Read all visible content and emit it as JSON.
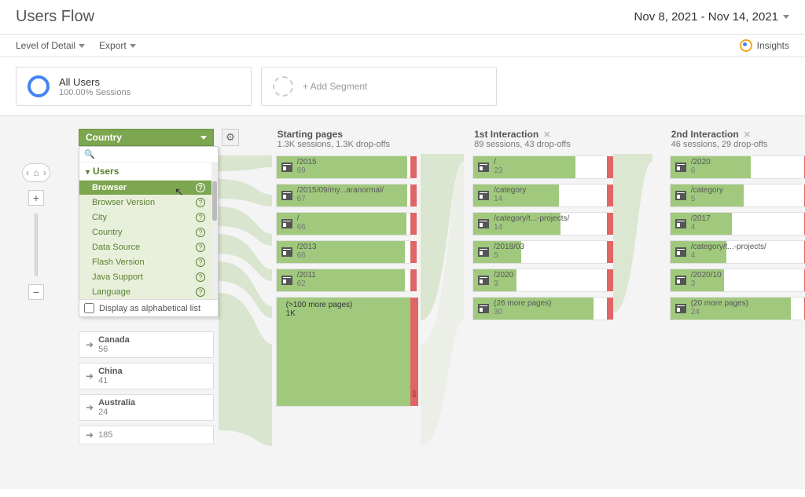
{
  "page_title": "Users Flow",
  "date_range": "Nov 8, 2021 - Nov 14, 2021",
  "toolbar": {
    "level_label": "Level of Detail",
    "export_label": "Export",
    "insights_label": "Insights"
  },
  "segments": {
    "primary_name": "All Users",
    "primary_sub": "100.00% Sessions",
    "add_label": "+ Add Segment"
  },
  "dimension_selector": {
    "selected": "Country",
    "search_placeholder": "",
    "group_header": "Users",
    "items": [
      {
        "label": "Browser",
        "selected": true
      },
      {
        "label": "Browser Version",
        "selected": false
      },
      {
        "label": "City",
        "selected": false
      },
      {
        "label": "Country",
        "selected": false
      },
      {
        "label": "Data Source",
        "selected": false
      },
      {
        "label": "Flash Version",
        "selected": false
      },
      {
        "label": "Java Support",
        "selected": false
      },
      {
        "label": "Language",
        "selected": false
      }
    ],
    "alpha_label": "Display as alphabetical list"
  },
  "dimension_values": [
    {
      "name": "Canada",
      "count": "56"
    },
    {
      "name": "China",
      "count": "41"
    },
    {
      "name": "Australia",
      "count": "24"
    },
    {
      "name": "",
      "count": "185"
    }
  ],
  "columns": [
    {
      "title": "Starting pages",
      "subtitle": "1.3K sessions, 1.3K drop-offs",
      "closable": false,
      "nodes": [
        {
          "path": "/2015",
          "value": "69",
          "bar_pct": 98,
          "drop": true
        },
        {
          "path": "/2015/09/my...aranormal/",
          "value": "67",
          "bar_pct": 98,
          "drop": true
        },
        {
          "path": "/",
          "value": "66",
          "bar_pct": 97,
          "drop": true
        },
        {
          "path": "/2013",
          "value": "66",
          "bar_pct": 96,
          "drop": true
        },
        {
          "path": "/2011",
          "value": "62",
          "bar_pct": 96,
          "drop": true
        }
      ],
      "more": {
        "path": "(>100 more pages)",
        "value": "1K",
        "big": true
      }
    },
    {
      "title": "1st Interaction",
      "subtitle": "89 sessions, 43 drop-offs",
      "closable": true,
      "nodes": [
        {
          "path": "/",
          "value": "23",
          "bar_pct": 76,
          "drop": true
        },
        {
          "path": "/category",
          "value": "14",
          "bar_pct": 64,
          "drop": true
        },
        {
          "path": "/category/t...-projects/",
          "value": "14",
          "bar_pct": 65,
          "drop": true
        },
        {
          "path": "/2018/03",
          "value": "5",
          "bar_pct": 36,
          "drop": true
        },
        {
          "path": "/2020",
          "value": "3",
          "bar_pct": 32,
          "drop": true
        }
      ],
      "more": {
        "path": "(26 more pages)",
        "value": "30",
        "big": false
      }
    },
    {
      "title": "2nd Interaction",
      "subtitle": "46 sessions, 29 drop-offs",
      "closable": true,
      "nodes": [
        {
          "path": "/2020",
          "value": "6",
          "bar_pct": 60,
          "drop": true
        },
        {
          "path": "/category",
          "value": "5",
          "bar_pct": 55,
          "drop": true
        },
        {
          "path": "/2017",
          "value": "4",
          "bar_pct": 46,
          "drop": true
        },
        {
          "path": "/category/t...-projects/",
          "value": "4",
          "bar_pct": 42,
          "drop": true
        },
        {
          "path": "/2020/10",
          "value": "3",
          "bar_pct": 40,
          "drop": true
        }
      ],
      "more": {
        "path": "(20 more pages)",
        "value": "24",
        "big": false
      }
    }
  ]
}
